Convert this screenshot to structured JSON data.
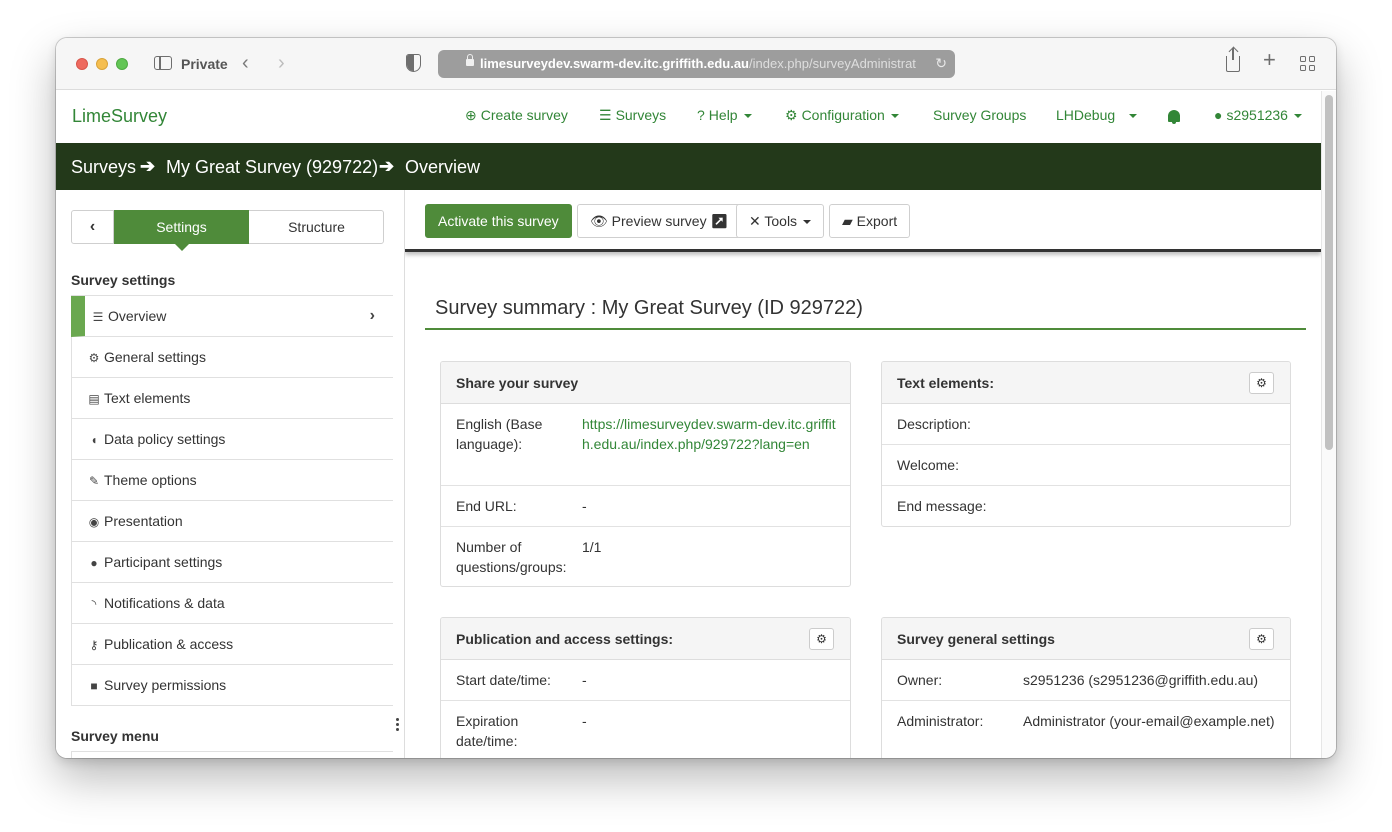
{
  "browser": {
    "private_label": "Private",
    "url_host": "limesurveydev.swarm-dev.itc.griffith.edu.au",
    "url_path": "/index.php/surveyAdministrat"
  },
  "app": {
    "brand": "LimeSurvey",
    "nav": {
      "create_survey": "Create survey",
      "surveys": "Surveys",
      "help": "Help",
      "configuration": "Configuration",
      "survey_groups": "Survey Groups",
      "lhdebug": "LHDebug",
      "user": "s2951236"
    },
    "breadcrumb": {
      "surveys": "Surveys",
      "survey": "My Great Survey (929722)",
      "overview": "Overview"
    }
  },
  "sidebar": {
    "tab_settings": "Settings",
    "tab_structure": "Structure",
    "section_settings": "Survey settings",
    "items": [
      {
        "label": "Overview",
        "icon": "list-icon"
      },
      {
        "label": "General settings",
        "icon": "cogs-icon"
      },
      {
        "label": "Text elements",
        "icon": "file-text-icon"
      },
      {
        "label": "Data policy settings",
        "icon": "shield-icon"
      },
      {
        "label": "Theme options",
        "icon": "paint-brush-icon"
      },
      {
        "label": "Presentation",
        "icon": "eye-slash-icon"
      },
      {
        "label": "Participant settings",
        "icon": "users-icon"
      },
      {
        "label": "Notifications & data",
        "icon": "rss-icon"
      },
      {
        "label": "Publication & access",
        "icon": "key-icon"
      },
      {
        "label": "Survey permissions",
        "icon": "lock-icon"
      }
    ],
    "section_menu": "Survey menu"
  },
  "toolbar": {
    "activate": "Activate this survey",
    "preview": "Preview survey",
    "tools": "Tools",
    "export": "Export"
  },
  "summary": {
    "title": "Survey summary : My Great Survey (ID 929722)"
  },
  "share_panel": {
    "title": "Share your survey",
    "rows": [
      {
        "key": "English (Base language):",
        "value": "https://limesurveydev.swarm-dev.itc.griffith.edu.au/index.php/929722?lang=en"
      },
      {
        "key": "End URL:",
        "value": "-"
      },
      {
        "key": "Number of questions/groups:",
        "value": "1/1"
      }
    ]
  },
  "text_panel": {
    "title": "Text elements:",
    "rows": [
      {
        "key": "Description:",
        "value": ""
      },
      {
        "key": "Welcome:",
        "value": ""
      },
      {
        "key": "End message:",
        "value": ""
      }
    ]
  },
  "publication_panel": {
    "title": "Publication and access settings:",
    "rows": [
      {
        "key": "Start date/time:",
        "value": "-"
      },
      {
        "key": "Expiration date/time:",
        "value": "-"
      }
    ]
  },
  "general_panel": {
    "title": "Survey general settings",
    "rows": [
      {
        "key": "Owner:",
        "value": "s2951236 (s2951236@griffith.edu.au)"
      },
      {
        "key": "Administrator:",
        "value": "Administrator (your-email@example.net)"
      }
    ]
  },
  "colors": {
    "brand_green": "#328637",
    "button_green": "#4f8b3a",
    "breadcrumb_bg": "#23391a"
  }
}
